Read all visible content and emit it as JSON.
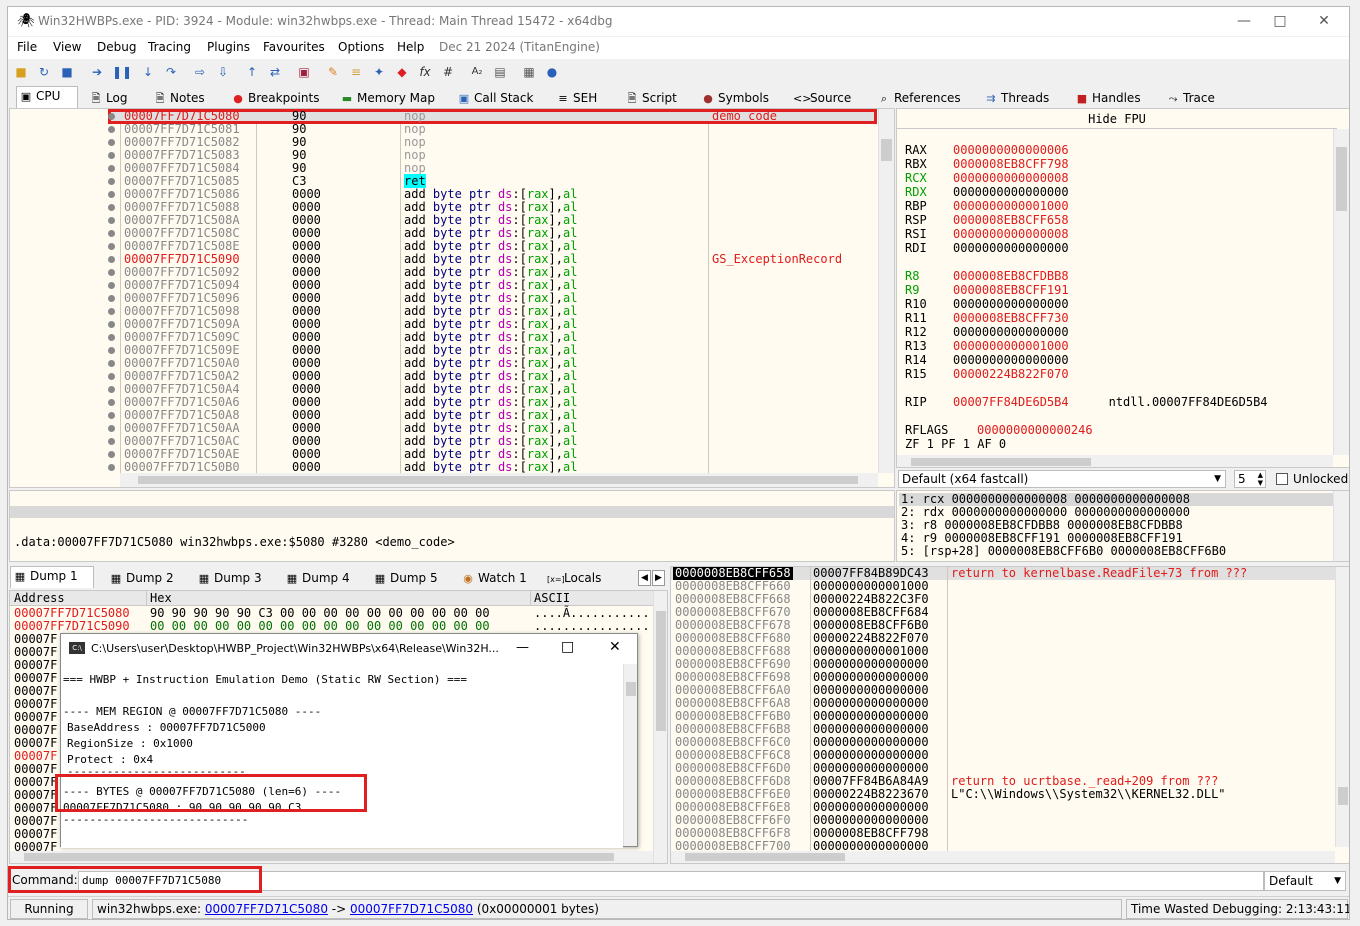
{
  "window": {
    "title": "Win32HWBPs.exe - PID: 3924 - Module: win32hwbps.exe - Thread: Main Thread 15472 - x64dbg"
  },
  "menu": {
    "items": [
      "File",
      "View",
      "Debug",
      "Tracing",
      "Plugins",
      "Favourites",
      "Options",
      "Help"
    ],
    "date": "Dec 21 2024 (TitanEngine)"
  },
  "tabs": [
    "CPU",
    "Log",
    "Notes",
    "Breakpoints",
    "Memory Map",
    "Call Stack",
    "SEH",
    "Script",
    "Symbols",
    "Source",
    "References",
    "Threads",
    "Handles",
    "Trace"
  ],
  "cpu": {
    "rows": [
      {
        "addr": "00007FF7D71C5080",
        "bytes": "90",
        "ins": "nop",
        "cmt": "demo_code",
        "red": true
      },
      {
        "addr": "00007FF7D71C5081",
        "bytes": "90",
        "ins": "nop",
        "cmt": "",
        "red": false
      },
      {
        "addr": "00007FF7D71C5082",
        "bytes": "90",
        "ins": "nop",
        "cmt": "",
        "red": false
      },
      {
        "addr": "00007FF7D71C5083",
        "bytes": "90",
        "ins": "nop",
        "cmt": "",
        "red": false
      },
      {
        "addr": "00007FF7D71C5084",
        "bytes": "90",
        "ins": "nop",
        "cmt": "",
        "red": false
      },
      {
        "addr": "00007FF7D71C5085",
        "bytes": "C3",
        "ins": "ret",
        "cmt": "",
        "red": false
      },
      {
        "addr": "00007FF7D71C5086",
        "bytes": "0000",
        "ins": "add",
        "cmt": "",
        "red": false
      },
      {
        "addr": "00007FF7D71C5088",
        "bytes": "0000",
        "ins": "add",
        "cmt": "",
        "red": false
      },
      {
        "addr": "00007FF7D71C508A",
        "bytes": "0000",
        "ins": "add",
        "cmt": "",
        "red": false
      },
      {
        "addr": "00007FF7D71C508C",
        "bytes": "0000",
        "ins": "add",
        "cmt": "",
        "red": false
      },
      {
        "addr": "00007FF7D71C508E",
        "bytes": "0000",
        "ins": "add",
        "cmt": "",
        "red": false
      },
      {
        "addr": "00007FF7D71C5090",
        "bytes": "0000",
        "ins": "add",
        "cmt": "GS_ExceptionRecord",
        "red": true
      },
      {
        "addr": "00007FF7D71C5092",
        "bytes": "0000",
        "ins": "add",
        "cmt": "",
        "red": false
      },
      {
        "addr": "00007FF7D71C5094",
        "bytes": "0000",
        "ins": "add",
        "cmt": "",
        "red": false
      },
      {
        "addr": "00007FF7D71C5096",
        "bytes": "0000",
        "ins": "add",
        "cmt": "",
        "red": false
      },
      {
        "addr": "00007FF7D71C5098",
        "bytes": "0000",
        "ins": "add",
        "cmt": "",
        "red": false
      },
      {
        "addr": "00007FF7D71C509A",
        "bytes": "0000",
        "ins": "add",
        "cmt": "",
        "red": false
      },
      {
        "addr": "00007FF7D71C509C",
        "bytes": "0000",
        "ins": "add",
        "cmt": "",
        "red": false
      },
      {
        "addr": "00007FF7D71C509E",
        "bytes": "0000",
        "ins": "add",
        "cmt": "",
        "red": false
      },
      {
        "addr": "00007FF7D71C50A0",
        "bytes": "0000",
        "ins": "add",
        "cmt": "",
        "red": false
      },
      {
        "addr": "00007FF7D71C50A2",
        "bytes": "0000",
        "ins": "add",
        "cmt": "",
        "red": false
      },
      {
        "addr": "00007FF7D71C50A4",
        "bytes": "0000",
        "ins": "add",
        "cmt": "",
        "red": false
      },
      {
        "addr": "00007FF7D71C50A6",
        "bytes": "0000",
        "ins": "add",
        "cmt": "",
        "red": false
      },
      {
        "addr": "00007FF7D71C50A8",
        "bytes": "0000",
        "ins": "add",
        "cmt": "",
        "red": false
      },
      {
        "addr": "00007FF7D71C50AA",
        "bytes": "0000",
        "ins": "add",
        "cmt": "",
        "red": false
      },
      {
        "addr": "00007FF7D71C50AC",
        "bytes": "0000",
        "ins": "add",
        "cmt": "",
        "red": false
      },
      {
        "addr": "00007FF7D71C50AE",
        "bytes": "0000",
        "ins": "add",
        "cmt": "",
        "red": false
      },
      {
        "addr": "00007FF7D71C50B0",
        "bytes": "0000",
        "ins": "add",
        "cmt": "",
        "red": false
      }
    ],
    "add_operands": {
      "kw": "byte",
      "ptr": "ptr",
      "seg": "ds",
      "colon": ":",
      "lb": "[",
      "reg": "rax",
      "rb": "],",
      "al": "al"
    }
  },
  "regs": {
    "header": "Hide FPU",
    "rows": [
      {
        "name": "RAX",
        "val": "0000000000000006",
        "red": true,
        "grn": false
      },
      {
        "name": "RBX",
        "val": "0000008EB8CFF798",
        "red": true,
        "grn": false
      },
      {
        "name": "RCX",
        "val": "0000000000000008",
        "red": true,
        "grn": true
      },
      {
        "name": "RDX",
        "val": "0000000000000000",
        "red": false,
        "grn": true
      },
      {
        "name": "RBP",
        "val": "0000000000001000",
        "red": true,
        "grn": false
      },
      {
        "name": "RSP",
        "val": "0000008EB8CFF658",
        "red": true,
        "grn": false
      },
      {
        "name": "RSI",
        "val": "0000000000000008",
        "red": true,
        "grn": false
      },
      {
        "name": "RDI",
        "val": "0000000000000000",
        "red": false,
        "grn": false
      },
      {
        "name": "R8",
        "val": "0000008EB8CFDBB8",
        "red": true,
        "grn": true
      },
      {
        "name": "R9",
        "val": "0000008EB8CFF191",
        "red": true,
        "grn": true
      },
      {
        "name": "R10",
        "val": "0000000000000000",
        "red": false,
        "grn": false
      },
      {
        "name": "R11",
        "val": "0000008EB8CFF730",
        "red": true,
        "grn": false
      },
      {
        "name": "R12",
        "val": "0000000000000000",
        "red": false,
        "grn": false
      },
      {
        "name": "R13",
        "val": "0000000000001000",
        "red": true,
        "grn": false
      },
      {
        "name": "R14",
        "val": "0000000000000000",
        "red": false,
        "grn": false
      },
      {
        "name": "R15",
        "val": "00000224B822F070",
        "red": true,
        "grn": false
      }
    ],
    "rip": {
      "name": "RIP",
      "val": "00007FF84DE6D5B4",
      "sym": "ntdll.00007FF84DE6D5B4"
    },
    "rflags": {
      "name": "RFLAGS",
      "val": "0000000000000246"
    },
    "flags": "ZF 1  PF 1  AF 0"
  },
  "conv": {
    "select": "Default (x64 fastcall)",
    "count": "5",
    "unlocked": "Unlocked"
  },
  "args": [
    "1: rcx 0000000000000008 0000000000000008",
    "2: rdx 0000000000000000 0000000000000000",
    "3: r8 0000008EB8CFDBB8 0000008EB8CFDBB8",
    "4: r9 0000008EB8CFF191 0000008EB8CFF191",
    "5: [rsp+28] 0000008EB8CFF6B0 0000008EB8CFF6B0"
  ],
  "info": {
    "line": ".data:00007FF7D71C5080 win32hwbps.exe:$5080 #3280 <demo_code>"
  },
  "dump_tabs": [
    "Dump 1",
    "Dump 2",
    "Dump 3",
    "Dump 4",
    "Dump 5",
    "Watch 1",
    "Locals"
  ],
  "dump": {
    "headers": {
      "addr": "Address",
      "hex": "Hex",
      "ascii": "ASCII"
    },
    "rows": [
      {
        "addr": "00007FF7D71C5080",
        "hex": "90 90 90 90 90 C3 00 00 00 00 00 00 00 00 00 00",
        "ascii": "....Ã..........."
      },
      {
        "addr": "00007FF7D71C5090",
        "hex": "00 00 00 00 00 00 00 00 00 00 00 00 00 00 00 00",
        "ascii": "................"
      }
    ],
    "stub_addr": "00007F"
  },
  "console": {
    "title": "C:\\Users\\user\\Desktop\\HWBP_Project\\Win32HWBPs\\x64\\Release\\Win32H...",
    "lines": [
      "=== HWBP + Instruction Emulation Demo (Static RW Section) ===",
      "",
      "---- MEM REGION @ 00007FF7D71C5080 ----",
      "BaseAddress   : 00007FF7D71C5000",
      "RegionSize    : 0x1000",
      "Protect       : 0x4",
      "---------------------------",
      "---- BYTES @ 00007FF7D71C5080 (len=6) ----",
      "00007FF7D71C5080 : 90 90 90 90 90 C3",
      "----------------------------"
    ]
  },
  "stack": {
    "rows": [
      {
        "a": "0000008EB8CFF658",
        "v": "00007FF84B89DC43",
        "c": "return to kernelbase.ReadFile+73 from ???",
        "sel": true
      },
      {
        "a": "0000008EB8CFF660",
        "v": "0000000000001000",
        "c": ""
      },
      {
        "a": "0000008EB8CFF668",
        "v": "00000224B822C3F0",
        "c": ""
      },
      {
        "a": "0000008EB8CFF670",
        "v": "0000008EB8CFF684",
        "c": ""
      },
      {
        "a": "0000008EB8CFF678",
        "v": "0000008EB8CFF6B0",
        "c": ""
      },
      {
        "a": "0000008EB8CFF680",
        "v": "00000224B822F070",
        "c": ""
      },
      {
        "a": "0000008EB8CFF688",
        "v": "0000000000001000",
        "c": ""
      },
      {
        "a": "0000008EB8CFF690",
        "v": "0000000000000000",
        "c": ""
      },
      {
        "a": "0000008EB8CFF698",
        "v": "0000000000000000",
        "c": ""
      },
      {
        "a": "0000008EB8CFF6A0",
        "v": "0000000000000000",
        "c": ""
      },
      {
        "a": "0000008EB8CFF6A8",
        "v": "0000000000000000",
        "c": ""
      },
      {
        "a": "0000008EB8CFF6B0",
        "v": "0000000000000000",
        "c": ""
      },
      {
        "a": "0000008EB8CFF6B8",
        "v": "0000000000000000",
        "c": ""
      },
      {
        "a": "0000008EB8CFF6C0",
        "v": "0000000000000000",
        "c": ""
      },
      {
        "a": "0000008EB8CFF6C8",
        "v": "0000000000000000",
        "c": ""
      },
      {
        "a": "0000008EB8CFF6D0",
        "v": "0000000000000000",
        "c": ""
      },
      {
        "a": "0000008EB8CFF6D8",
        "v": "00007FF84B6A84A9",
        "c": "return to ucrtbase._read+209 from ???"
      },
      {
        "a": "0000008EB8CFF6E0",
        "v": "00000224B8223670",
        "c": "L\"C:\\\\Windows\\\\System32\\\\KERNEL32.DLL\"",
        "blk": true
      },
      {
        "a": "0000008EB8CFF6E8",
        "v": "0000000000000000",
        "c": ""
      },
      {
        "a": "0000008EB8CFF6F0",
        "v": "0000000000000000",
        "c": ""
      },
      {
        "a": "0000008EB8CFF6F8",
        "v": "0000008EB8CFF798",
        "c": ""
      },
      {
        "a": "0000008EB8CFF700",
        "v": "0000000000000000",
        "c": ""
      }
    ]
  },
  "command": {
    "label": "Command:",
    "value": "dump 00007FF7D71C5080",
    "mode": "Default"
  },
  "status": {
    "state": "Running",
    "module": "win32hwbps.exe:",
    "from": "00007FF7D71C5080",
    "arrow": "->",
    "to": "00007FF7D71C5080",
    "size": "(0x00000001 bytes)",
    "time": "Time Wasted Debugging: 2:13:43:11"
  }
}
